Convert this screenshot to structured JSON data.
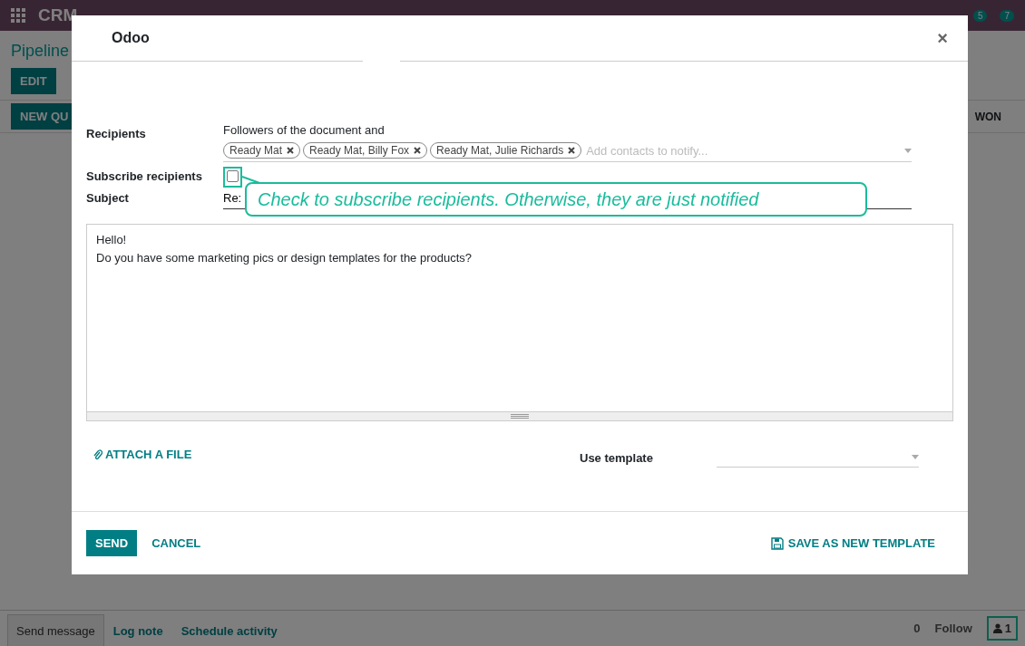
{
  "app_bar": {
    "app_name": "CRM",
    "badges": [
      "5",
      "7"
    ]
  },
  "page": {
    "breadcrumb": "Pipeline",
    "edit_button": "EDIT",
    "quote_button": "NEW QU",
    "stage": "WON"
  },
  "chatter": {
    "tabs": [
      {
        "label": "Send message",
        "selected": true
      },
      {
        "label": "Log note",
        "selected": false
      },
      {
        "label": "Schedule activity",
        "selected": false
      }
    ],
    "attachments": "0",
    "follow": "Follow",
    "followers": "1"
  },
  "dialog": {
    "title": "Odoo",
    "close": "×",
    "recipients": {
      "label": "Recipients",
      "intro": "Followers of the document and",
      "tags": [
        "Ready Mat",
        "Ready Mat, Billy Fox",
        "Ready Mat, Julie Richards"
      ],
      "placeholder": "Add contacts to notify..."
    },
    "subscribe": {
      "label": "Subscribe recipients",
      "checked": false
    },
    "subject": {
      "label": "Subject",
      "value": "Re:"
    },
    "body": [
      "Hello!",
      "Do you have some marketing pics or design templates for the products?"
    ],
    "attach": "ATTACH A FILE",
    "template": {
      "label": "Use template"
    },
    "buttons": {
      "send": "SEND",
      "cancel": "CANCEL",
      "save_template": "SAVE AS NEW TEMPLATE"
    }
  },
  "callout": {
    "text": "Check to subscribe recipients. Otherwise, they are just notified"
  }
}
